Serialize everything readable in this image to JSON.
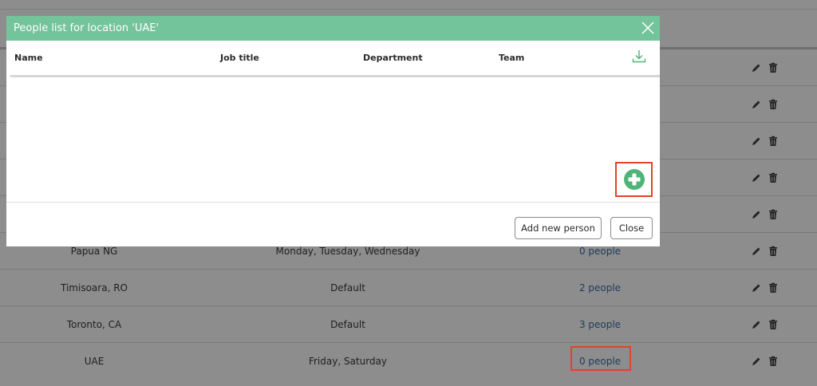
{
  "modal": {
    "title": "People list for location 'UAE'",
    "columns": {
      "name": "Name",
      "job_title": "Job title",
      "department": "Department",
      "team": "Team"
    },
    "add_button": "Add new person",
    "close_button": "Close"
  },
  "rows": [
    {
      "name": "Papua NG",
      "days": "Monday, Tuesday, Wednesday",
      "people": "0 people"
    },
    {
      "name": "Timisoara, RO",
      "days": "Default",
      "people": "2 people"
    },
    {
      "name": "Toronto, CA",
      "days": "Default",
      "people": "3 people"
    },
    {
      "name": "UAE",
      "days": "Friday, Saturday",
      "people": "0 people"
    }
  ],
  "icons": {
    "edit": "pencil-icon",
    "delete": "trash-icon",
    "download": "download-icon",
    "add": "plus-circle-icon",
    "close": "close-icon"
  },
  "colors": {
    "header": "#73c39b",
    "add_icon": "#4fb477",
    "highlight": "#e0442a",
    "link": "#1e3a5c"
  }
}
